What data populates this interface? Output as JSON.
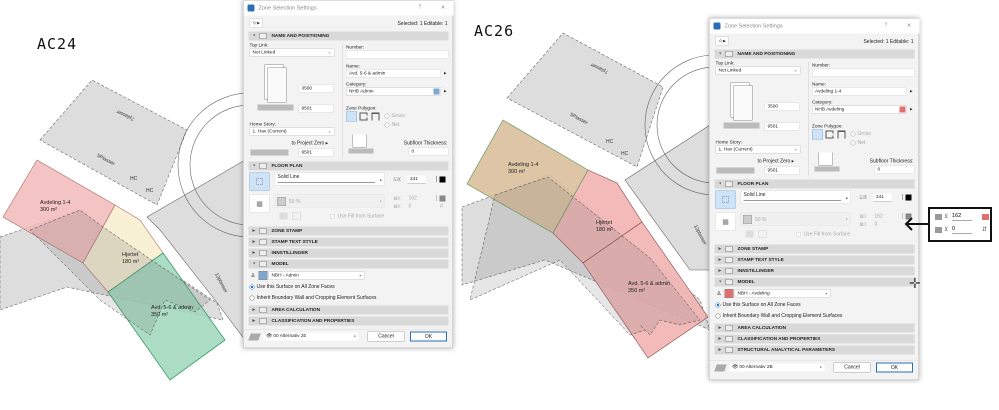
{
  "labels": {
    "left": "AC24",
    "right": "AC26"
  },
  "plan_left": {
    "zones": [
      {
        "name": "Avdeling 1-4",
        "area": "300 m²",
        "color": "#f2b8b8"
      },
      {
        "name": "Hjertet",
        "area": "180 m²",
        "color": "#f7efcf"
      },
      {
        "name": "Avd. 5-6 & admin",
        "area": "350 m²",
        "color": "#9fd6bb"
      }
    ],
    "parking": [
      "7plasser",
      "5Plasser",
      "HC",
      "HC",
      "12plasser"
    ]
  },
  "plan_right": {
    "zones": [
      {
        "name": "Avdeling 1-4",
        "area": "300 m²",
        "color": "#d9bf9c"
      },
      {
        "name": "Hjertet",
        "area": "180 m²",
        "color": "#f2b3b3"
      },
      {
        "name": "Avd. 5-6 & admin",
        "area": "350 m²",
        "color": "#f2b3b3"
      }
    ],
    "parking": [
      "7plasser",
      "5Plasser",
      "HC",
      "HC",
      "12plasser"
    ]
  },
  "dialogs": [
    {
      "title": "Zone Selection Settings",
      "help": "?",
      "close": "×",
      "selected": "Selected: 1 Editable: 1",
      "sections": {
        "name_pos": "NAME AND POSITIONING",
        "floor_plan": "FLOOR PLAN",
        "zone_stamp": "ZONE STAMP",
        "stamp_text": "STAMP TEXT STYLE",
        "innstillinger": "INNSTILLINGER",
        "model": "MODEL",
        "area_calc": "AREA CALCULATION",
        "classification": "CLASSIFICATION AND PROPERTIES"
      },
      "top_link_label": "Top Link:",
      "top_link": "Not Linked",
      "height": "3500",
      "offset": "9501",
      "home_story_label": "Home Story:",
      "home_story": "1. Hav (Current)",
      "project_zero_label": "to Project Zero",
      "project_zero": "9501",
      "number_label": "Number:",
      "number": "",
      "name_label": "Name:",
      "name": "Avd. 5-6 & admin",
      "category_label": "Category:",
      "category": "NHB  Admin",
      "category_color": "#7ea6cf",
      "zone_polygon_label": "Zone Polygon:",
      "gross": "Gross",
      "net": "Net",
      "subfloor_label": "Subfloor Thickness:",
      "subfloor": "0",
      "line_type": "Solid Line",
      "pen1": "241",
      "fill": "50 %",
      "pen2": "162",
      "pen3": "0",
      "use_fill": "Use Fill from Surface",
      "surface": "NBH - Admin",
      "surface_color": "#7ea6cf",
      "radio1": "Use this Surface on All Zone Faces",
      "radio2": "Inherit Boundary Wall and Cropping Element Surfaces",
      "layer": "00 Alternativ 2b",
      "cancel": "Cancel",
      "ok": "OK"
    },
    {
      "title": "Zone Selection Settings",
      "help": "?",
      "close": "×",
      "selected": "Selected: 1 Editable: 1",
      "sections": {
        "name_pos": "NAME AND POSITIONING",
        "floor_plan": "FLOOR PLAN",
        "zone_stamp": "ZONE STAMP",
        "stamp_text": "STAMP TEXT STYLE",
        "innstillinger": "INNSTILLINGER",
        "model": "MODEL",
        "area_calc": "AREA CALCULATION",
        "classification": "CLASSIFICATION AND PROPERTIES",
        "structural": "STRUCTURAL ANALYTICAL PARAMETERS"
      },
      "top_link_label": "Top Link:",
      "top_link": "Not Linked",
      "height": "3500",
      "offset": "9501",
      "home_story_label": "Home Story:",
      "home_story": "1. Hav (Current)",
      "project_zero_label": "to Project Zero",
      "project_zero": "9501",
      "number_label": "Number:",
      "number": "",
      "name_label": "Name:",
      "name": "Avdeling 1-4",
      "category_label": "Category:",
      "category": "NHB  Avdeling",
      "category_color": "#e07070",
      "zone_polygon_label": "Zone Polygon:",
      "gross": "Gross",
      "net": "Net",
      "subfloor_label": "Subfloor Thickness:",
      "subfloor": "0",
      "line_type": "Solid Line",
      "pen1": "241",
      "fill": "50 %",
      "pen2": "162",
      "pen3": "0",
      "use_fill": "Use Fill from Surface",
      "surface": "NBH - Avdeling",
      "surface_color": "#e07070",
      "radio1": "Use this Surface on All Zone Faces",
      "radio2": "Inherit Boundary Wall and Cropping Element Surfaces",
      "layer": "00 Alternativ 2B",
      "cancel": "Cancel",
      "ok": "OK"
    }
  ],
  "callout": {
    "pen2": "162",
    "pen3": "0",
    "color": "#e07070"
  }
}
